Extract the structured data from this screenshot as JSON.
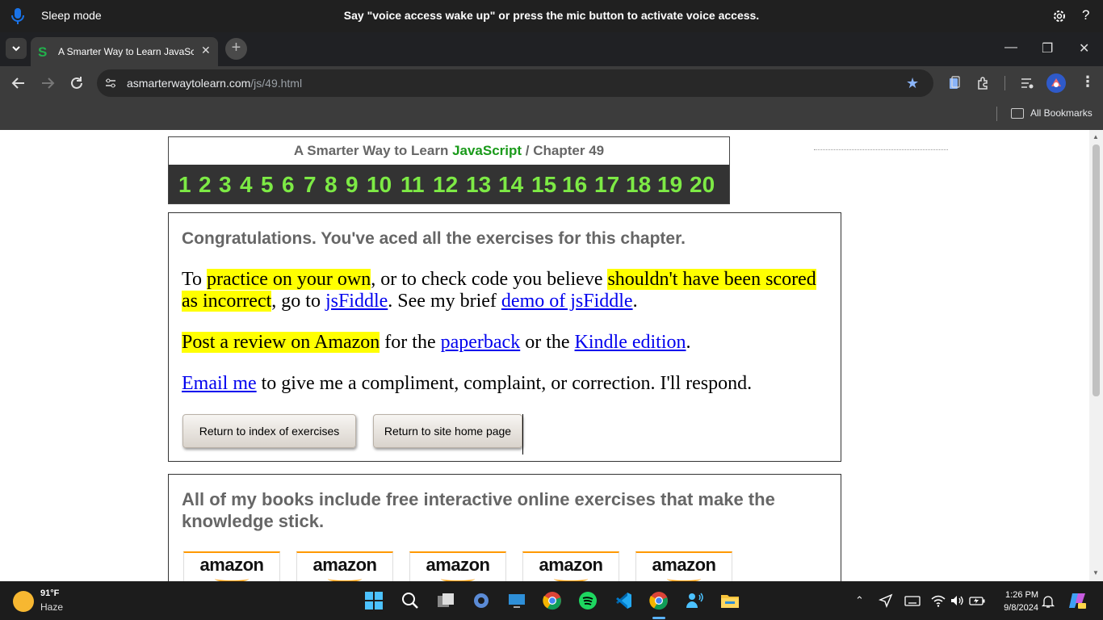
{
  "voice_access": {
    "status": "Sleep mode",
    "message": "Say \"voice access wake up\" or press the mic button to activate voice access.",
    "help": "?"
  },
  "browser": {
    "tab_title": "A Smarter Way to Learn JavaScript",
    "url_host": "asmarterwaytolearn.com",
    "url_path": "/js/49.html",
    "bookmarks_label": "All Bookmarks"
  },
  "page": {
    "header_prefix": "A Smarter Way to Learn ",
    "header_lang": "JavaScript",
    "header_sep": " / ",
    "header_chapter": "Chapter 49",
    "chapters": [
      "1",
      "2",
      "3",
      "4",
      "5",
      "6",
      "7",
      "8",
      "9",
      "10",
      "11",
      "12",
      "13",
      "14",
      "15",
      "16",
      "17",
      "18",
      "19",
      "20"
    ],
    "congrats": "Congratulations. You've aced all the exercises for this chapter.",
    "p1_a": "To ",
    "p1_hl1": "practice on your own",
    "p1_b": ", or to check code you believe ",
    "p1_hl2": "shouldn't have been scored as incorrect",
    "p1_c": ", go to ",
    "p1_link1": "jsFiddle",
    "p1_d": ". See my brief ",
    "p1_link2": "demo of jsFiddle",
    "p1_e": ".",
    "p2_hl": "Post a review on Amazon",
    "p2_a": " for the ",
    "p2_link1": "paperback",
    "p2_b": " or the ",
    "p2_link2": "Kindle edition",
    "p2_c": ".",
    "p3_link": "Email me",
    "p3_a": " to give me a compliment, complaint, or correction. I'll respond.",
    "btn_index": "Return to index of exercises",
    "btn_home": "Return to site home page",
    "books_text": "All of my books include free interactive online exercises that make the knowledge stick.",
    "amazon_label": "amazon"
  },
  "taskbar": {
    "temp": "91°F",
    "condition": "Haze",
    "time": "1:26 PM",
    "date": "9/8/2024"
  }
}
